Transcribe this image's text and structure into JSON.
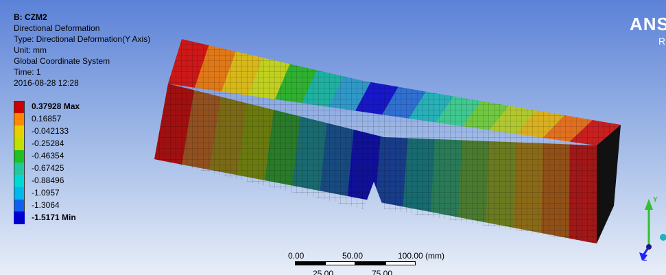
{
  "header": {
    "title": "B: CZM2",
    "result": "Directional Deformation",
    "type": "Type: Directional Deformation(Y Axis)",
    "unit": "Unit: mm",
    "coord": "Global Coordinate System",
    "time": "Time: 1",
    "date": "2016-08-28 12:28"
  },
  "legend": {
    "entries": [
      {
        "label": "0.37928 Max",
        "color": "#cc0000",
        "bold": true
      },
      {
        "label": "0.16857",
        "color": "#ff8800",
        "bold": false
      },
      {
        "label": "-0.042133",
        "color": "#e8d000",
        "bold": false
      },
      {
        "label": "-0.25284",
        "color": "#c0e000",
        "bold": false
      },
      {
        "label": "-0.46354",
        "color": "#20c020",
        "bold": false
      },
      {
        "label": "-0.67425",
        "color": "#20c8a0",
        "bold": false
      },
      {
        "label": "-0.88496",
        "color": "#00d8d8",
        "bold": false
      },
      {
        "label": "-1.0957",
        "color": "#00b8f0",
        "bold": false
      },
      {
        "label": "-1.3064",
        "color": "#1060f0",
        "bold": false
      },
      {
        "label": "-1.5171 Min",
        "color": "#0000cc",
        "bold": true
      }
    ]
  },
  "logo": {
    "text": "ANS",
    "sub": "R"
  },
  "scale": {
    "top_labels": [
      "0.00",
      "50.00",
      "100.00 (mm)"
    ],
    "bottom_labels": [
      "25.00",
      "75.00"
    ]
  },
  "triad": {
    "y_label": "Y",
    "z_label": "Z",
    "y_color": "#30c030",
    "z_color": "#2020ff",
    "x_color": "#20b0c0"
  },
  "model": {
    "top_band_colors": [
      "#cc1818",
      "#e07818",
      "#d8b818",
      "#c0d020",
      "#30b030",
      "#20b0a0",
      "#3098c8",
      "#1818c8",
      "#3070d0",
      "#28b0b8",
      "#40c890",
      "#70c840",
      "#b0c830",
      "#d8b020",
      "#e07020",
      "#c82020"
    ],
    "front_band_colors": [
      "#a01010",
      "#905020",
      "#7a6a18",
      "#6a7a10",
      "#2a7a2a",
      "#1a6a70",
      "#184a80",
      "#101098",
      "#183c88",
      "#186a70",
      "#2a7a58",
      "#4a7a30",
      "#6a7a20",
      "#8a6a18",
      "#905018",
      "#a01818"
    ]
  }
}
